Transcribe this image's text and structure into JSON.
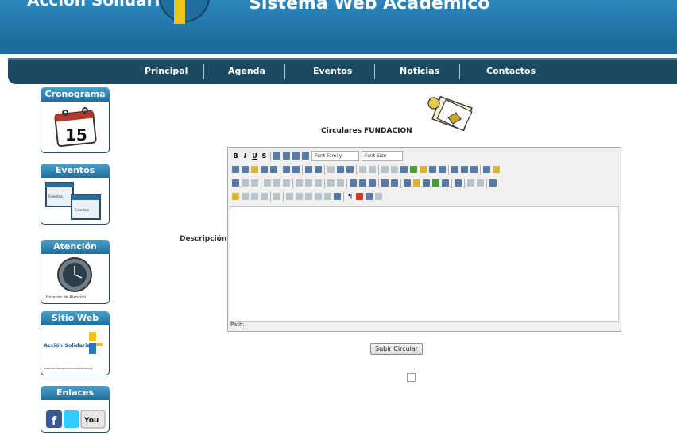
{
  "header": {
    "brand": "Acción Solidaria",
    "system_name": "Sistema Web Académico"
  },
  "nav": {
    "items": [
      "Principal",
      "Agenda",
      "Eventos",
      "Noticias",
      "Contactos"
    ]
  },
  "sidebar": {
    "items": [
      {
        "title": "Cronograma",
        "content": "15"
      },
      {
        "title": "Eventos",
        "content": "Eventos"
      },
      {
        "title": "Atención",
        "content": "Horarios de Atención"
      },
      {
        "title": "Sitio Web",
        "content": "Acción Solidaria",
        "url": "www.fundacionaccionsolidaria.org"
      },
      {
        "title": "Enlaces",
        "content": "You"
      }
    ]
  },
  "content": {
    "title": "Circulares FUNDACION",
    "description_label": "Descripción:",
    "editor": {
      "font_family_label": "Font Family",
      "font_size_label": "Font Size",
      "path_label": "Path:",
      "content": ""
    },
    "submit_label": "Subir Circular"
  },
  "colors": {
    "header_blue": "#1f6f9e",
    "nav_dark": "#1d4a63",
    "accent_yellow": "#f4c01c"
  }
}
